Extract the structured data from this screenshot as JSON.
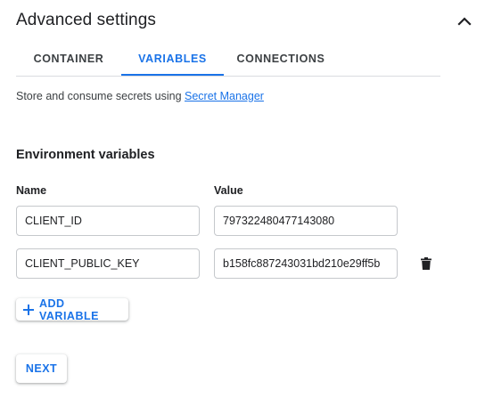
{
  "header": {
    "title": "Advanced settings",
    "collapse_icon": "chevron-up-icon"
  },
  "tabs": [
    {
      "label": "CONTAINER",
      "active": false
    },
    {
      "label": "VARIABLES",
      "active": true
    },
    {
      "label": "CONNECTIONS",
      "active": false
    }
  ],
  "description": {
    "text": "Store and consume secrets using ",
    "link": "Secret Manager"
  },
  "env": {
    "title": "Environment variables",
    "name_header": "Name",
    "value_header": "Value",
    "rows": [
      {
        "name": "CLIENT_ID",
        "value": "797322480477143080"
      },
      {
        "name": "CLIENT_PUBLIC_KEY",
        "value": "b158fc887243031bd210e29ff5b"
      }
    ],
    "delete_icon": "trash-icon"
  },
  "buttons": {
    "add_variable": "ADD VARIABLE",
    "next": "NEXT"
  },
  "colors": {
    "accent": "#1a73e8",
    "text": "#202124",
    "border": "#dadce0"
  }
}
